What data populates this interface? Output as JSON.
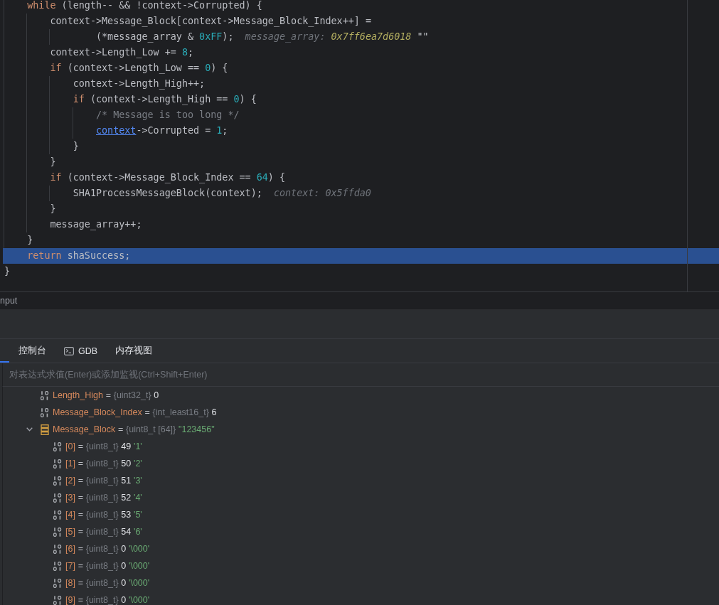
{
  "editor": {
    "body": [
      {
        "kind": "code",
        "current": false,
        "tokens": [
          {
            "kind": "keyword",
            "text": "while"
          },
          {
            "kind": "plain",
            "text": " (length-- && !context->Corrupted) {"
          }
        ],
        "children": [
          {
            "kind": "code",
            "current": false,
            "tokens": [
              {
                "kind": "plain",
                "text": "context->Message_Block[context->Message_Block_Index++] ="
              }
            ],
            "children": [
              {
                "kind": "continuation",
                "current": false,
                "tokens": [
                  {
                    "kind": "plain",
                    "text": "(*message_array & "
                  },
                  {
                    "kind": "number",
                    "text": "0xFF"
                  },
                  {
                    "kind": "plain",
                    "text": ");"
                  }
                ],
                "hint": [
                  {
                    "kind": "label",
                    "text": "message_array:"
                  },
                  {
                    "kind": "changed",
                    "text": "0x7ff6ea7d6018"
                  },
                  {
                    "kind": "string",
                    "text": "\"\""
                  }
                ]
              }
            ]
          },
          {
            "kind": "code",
            "current": false,
            "tokens": [
              {
                "kind": "plain",
                "text": "context->Length_Low += "
              },
              {
                "kind": "number",
                "text": "8"
              },
              {
                "kind": "plain",
                "text": ";"
              }
            ]
          },
          {
            "kind": "code",
            "current": false,
            "tokens": [
              {
                "kind": "keyword",
                "text": "if"
              },
              {
                "kind": "plain",
                "text": " (context->Length_Low == "
              },
              {
                "kind": "number",
                "text": "0"
              },
              {
                "kind": "plain",
                "text": ") {"
              }
            ],
            "children": [
              {
                "kind": "code",
                "current": false,
                "tokens": [
                  {
                    "kind": "plain",
                    "text": "context->Length_High++;"
                  }
                ]
              },
              {
                "kind": "code",
                "current": false,
                "tokens": [
                  {
                    "kind": "keyword",
                    "text": "if"
                  },
                  {
                    "kind": "plain",
                    "text": " (context->Length_High == "
                  },
                  {
                    "kind": "number",
                    "text": "0"
                  },
                  {
                    "kind": "plain",
                    "text": ") {"
                  }
                ],
                "children": [
                  {
                    "kind": "code",
                    "current": false,
                    "tokens": [
                      {
                        "kind": "comment",
                        "text": "/* Message is too long */"
                      }
                    ]
                  },
                  {
                    "kind": "code",
                    "current": false,
                    "tokens": [
                      {
                        "kind": "link",
                        "text": "context"
                      },
                      {
                        "kind": "plain",
                        "text": "->Corrupted = "
                      },
                      {
                        "kind": "number",
                        "text": "1"
                      },
                      {
                        "kind": "plain",
                        "text": ";"
                      }
                    ]
                  }
                ]
              },
              {
                "kind": "code",
                "current": false,
                "tokens": [
                  {
                    "kind": "plain",
                    "text": "}"
                  }
                ]
              }
            ]
          },
          {
            "kind": "code",
            "current": false,
            "tokens": [
              {
                "kind": "plain",
                "text": "}"
              }
            ]
          },
          {
            "kind": "code",
            "current": false,
            "tokens": [
              {
                "kind": "keyword",
                "text": "if"
              },
              {
                "kind": "plain",
                "text": " (context->Message_Block_Index == "
              },
              {
                "kind": "number",
                "text": "64"
              },
              {
                "kind": "plain",
                "text": ") {"
              }
            ],
            "children": [
              {
                "kind": "code",
                "current": false,
                "tokens": [
                  {
                    "kind": "plain",
                    "text": "SHA1ProcessMessageBlock(context);"
                  }
                ],
                "hint": [
                  {
                    "kind": "label",
                    "text": "context:"
                  },
                  {
                    "kind": "value",
                    "text": "0x5ffda0"
                  }
                ]
              }
            ]
          },
          {
            "kind": "code",
            "current": false,
            "tokens": [
              {
                "kind": "plain",
                "text": "}"
              }
            ]
          },
          {
            "kind": "code",
            "current": false,
            "tokens": [
              {
                "kind": "plain",
                "text": "message_array++;"
              }
            ]
          }
        ]
      },
      {
        "kind": "code",
        "current": false,
        "tokens": [
          {
            "kind": "plain",
            "text": "}"
          }
        ]
      },
      {
        "kind": "code",
        "current": true,
        "tokens": [
          {
            "kind": "keyword",
            "text": "return"
          },
          {
            "kind": "plain",
            "text": " shaSuccess;"
          }
        ]
      }
    ],
    "closing": {
      "kind": "code",
      "current": false,
      "tokens": [
        {
          "kind": "plain",
          "text": "}"
        }
      ]
    }
  },
  "output_strip": {
    "label": "nput"
  },
  "debugger": {
    "tabs": [
      {
        "kind": "text",
        "selected": true
      },
      {
        "kind": "text",
        "label": "控制台",
        "selected": false
      },
      {
        "kind": "icon",
        "label": "GDB",
        "selected": false
      },
      {
        "kind": "text",
        "label": "内存视图",
        "selected": false
      }
    ],
    "evaluate_field": {
      "placeholder": "对表达式求值(Enter)或添加监视(Ctrl+Shift+Enter)"
    },
    "variables": [
      {
        "kind": "scalar",
        "name": "Length_High",
        "op": "=",
        "type": "{uint32_t}",
        "value": "0"
      },
      {
        "kind": "scalar",
        "name": "Message_Block_Index",
        "op": "=",
        "type": "{int_least16_t}",
        "value": "6"
      },
      {
        "kind": "array",
        "expanded": true,
        "name": "Message_Block",
        "op": "=",
        "type": "{uint8_t [64]}",
        "string": "\"123456\"",
        "children": [
          {
            "kind": "scalar",
            "name": "[0]",
            "op": "=",
            "type": "{uint8_t}",
            "value": "49",
            "string": "'1'"
          },
          {
            "kind": "scalar",
            "name": "[1]",
            "op": "=",
            "type": "{uint8_t}",
            "value": "50",
            "string": "'2'"
          },
          {
            "kind": "scalar",
            "name": "[2]",
            "op": "=",
            "type": "{uint8_t}",
            "value": "51",
            "string": "'3'"
          },
          {
            "kind": "scalar",
            "name": "[3]",
            "op": "=",
            "type": "{uint8_t}",
            "value": "52",
            "string": "'4'"
          },
          {
            "kind": "scalar",
            "name": "[4]",
            "op": "=",
            "type": "{uint8_t}",
            "value": "53",
            "string": "'5'"
          },
          {
            "kind": "scalar",
            "name": "[5]",
            "op": "=",
            "type": "{uint8_t}",
            "value": "54",
            "string": "'6'"
          },
          {
            "kind": "scalar",
            "name": "[6]",
            "op": "=",
            "type": "{uint8_t}",
            "value": "0",
            "string": "'\\000'"
          },
          {
            "kind": "scalar",
            "name": "[7]",
            "op": "=",
            "type": "{uint8_t}",
            "value": "0",
            "string": "'\\000'"
          },
          {
            "kind": "scalar",
            "name": "[8]",
            "op": "=",
            "type": "{uint8_t}",
            "value": "0",
            "string": "'\\000'"
          },
          {
            "kind": "scalar",
            "name": "[9]",
            "op": "=",
            "type": "{uint8_t}",
            "value": "0",
            "string": "'\\000'"
          }
        ]
      }
    ]
  }
}
